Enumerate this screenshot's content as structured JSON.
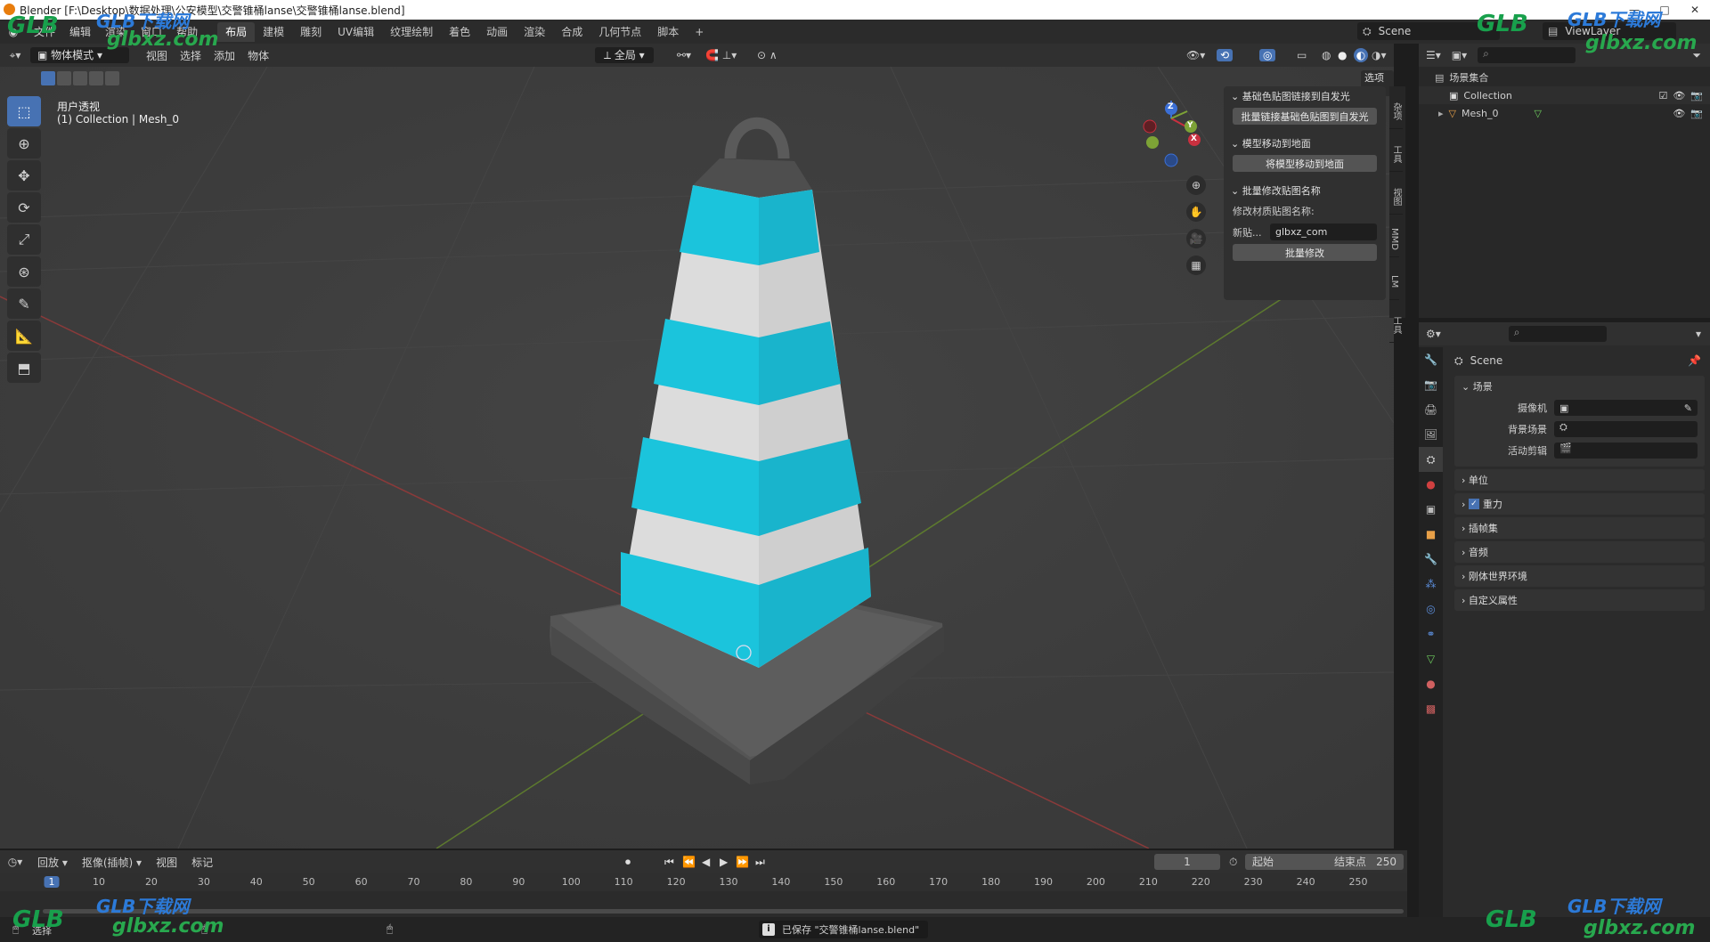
{
  "window": {
    "title": "Blender [F:\\Desktop\\数据处理\\公安模型\\交警锥桶lanse\\交警锥桶lanse.blend]",
    "min": "—",
    "max": "□",
    "close": "✕"
  },
  "menu": {
    "items": [
      "文件",
      "编辑",
      "渲染",
      "窗口",
      "帮助"
    ],
    "workspaces": [
      "布局",
      "建模",
      "雕刻",
      "UV编辑",
      "纹理绘制",
      "着色",
      "动画",
      "渲染",
      "合成",
      "几何节点",
      "脚本"
    ],
    "add": "+",
    "scene": "Scene",
    "viewlayer": "ViewLayer"
  },
  "viewport_header": {
    "mode": "物体模式",
    "view": "视图",
    "select": "选择",
    "add": "添加",
    "object": "物体",
    "orientation": "全局",
    "options": "选项"
  },
  "viewport": {
    "view_name": "用户透视",
    "collection_info": "(1) Collection | Mesh_0",
    "cone_colors": {
      "stripe_blue": "#1bc4dc",
      "stripe_white": "#dcdcdc",
      "base": "#5a5a5a"
    },
    "gizmo": {
      "z": "Z",
      "y": "Y",
      "x": "X"
    }
  },
  "npanel": {
    "sec1": "基础色贴图链接到自发光",
    "btn1": "批量链接基础色贴图到自发光",
    "sec2": "模型移动到地面",
    "btn2": "将模型移动到地面",
    "sec3": "批量修改贴图名称",
    "label_modify": "修改材质贴图名称:",
    "new_label": "新贴...",
    "new_value": "glbxz_com",
    "btn3": "批量修改",
    "tabs": [
      "杂项",
      "工具",
      "视图",
      "MMD",
      "LM",
      "工具"
    ]
  },
  "outliner": {
    "root": "场景集合",
    "collection": "Collection",
    "mesh": "Mesh_0"
  },
  "properties": {
    "scene_name": "Scene",
    "section": "场景",
    "camera_label": "摄像机",
    "bg_label": "背景场景",
    "clip_label": "活动剪辑",
    "panels": [
      "单位",
      "重力",
      "插帧集",
      "音频",
      "刚体世界环境",
      "自定义属性"
    ]
  },
  "timeline": {
    "playback": "回放",
    "keying": "抠像(插帧)",
    "view": "视图",
    "marker": "标记",
    "current": "1",
    "start_label": "起始",
    "start": "1",
    "end_label": "结束点",
    "end": "250",
    "ticks": [
      "1",
      "10",
      "20",
      "30",
      "40",
      "50",
      "60",
      "70",
      "80",
      "90",
      "100",
      "110",
      "120",
      "130",
      "140",
      "150",
      "160",
      "170",
      "180",
      "190",
      "200",
      "210",
      "220",
      "230",
      "240",
      "250"
    ]
  },
  "status": {
    "left": "选择",
    "message": "已保存 \"交警锥桶lanse.blend\""
  },
  "watermark": {
    "brand": "GLB下载网",
    "url": "glbxz.com",
    "logo": "GLB"
  }
}
